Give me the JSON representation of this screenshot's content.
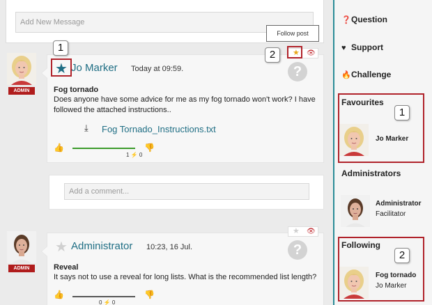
{
  "composer": {
    "placeholder": "Add New Message"
  },
  "tooltip": {
    "text": "Follow post"
  },
  "posts": [
    {
      "badge": "ADMIN",
      "author": "Jo Marker",
      "time": "Today at 09:59.",
      "title": "Fog tornado",
      "body": "Does anyone have some advice for me as my fog tornado won't work? I have followed the attached instructions..",
      "attachment": "Fog Tornado_Instructions.txt",
      "votes": "1 ⚡ 0",
      "favourited": true,
      "followed": true,
      "comment_placeholder": "Add a comment..."
    },
    {
      "badge": "ADMIN",
      "author": "Administrator",
      "time": "10:23, 16 Jul.",
      "title": "Reveal",
      "body": "It says not to use a reveal for long lists. What is the recommended list length?",
      "votes": "0 ⚡ 0",
      "favourited": false,
      "followed": false
    }
  ],
  "callouts": {
    "one": "1",
    "two": "2"
  },
  "sidebar": {
    "links": [
      {
        "label": "Question",
        "icon": "question-circle-icon"
      },
      {
        "label": "Support",
        "icon": "heart-icon"
      },
      {
        "label": "Challenge",
        "icon": "flame-icon"
      }
    ],
    "favourites": {
      "heading": "Favourites",
      "name": "Jo Marker"
    },
    "administrators": {
      "heading": "Administrators",
      "name": "Administrator",
      "role": "Facilitator"
    },
    "following": {
      "heading": "Following",
      "topic": "Fog tornado",
      "author": "Jo Marker"
    }
  },
  "colors": {
    "accent": "#2a8c97",
    "author": "#1f6e84",
    "admin_badge": "#b01c1c",
    "highlight": "#b0222a",
    "vote_up": "#3a9a2a"
  }
}
